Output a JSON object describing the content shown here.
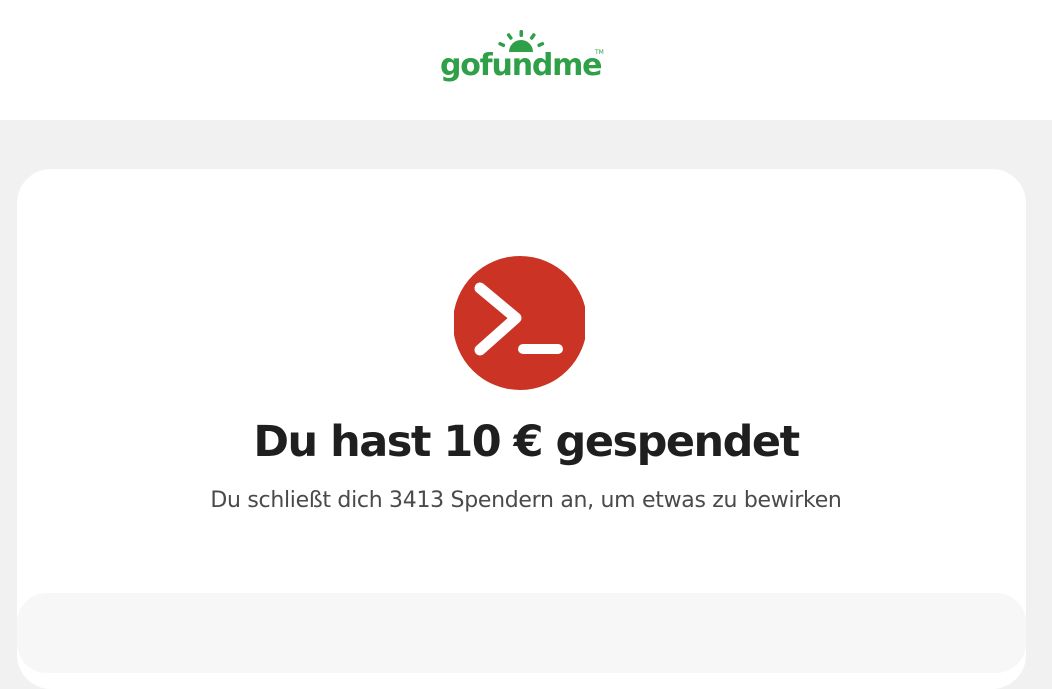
{
  "header": {
    "logo_text": "gofundme",
    "logo_tm": "TM"
  },
  "confirmation": {
    "icon": "terminal-prompt-icon",
    "headline": "Du hast 10 € gespendet",
    "subline": "Du schließt dich 3413 Spendern an, um etwas zu bewirken"
  },
  "colors": {
    "brand_green": "#2f9f48",
    "badge_red": "#cb3324",
    "page_bg": "#f1f1f1"
  }
}
